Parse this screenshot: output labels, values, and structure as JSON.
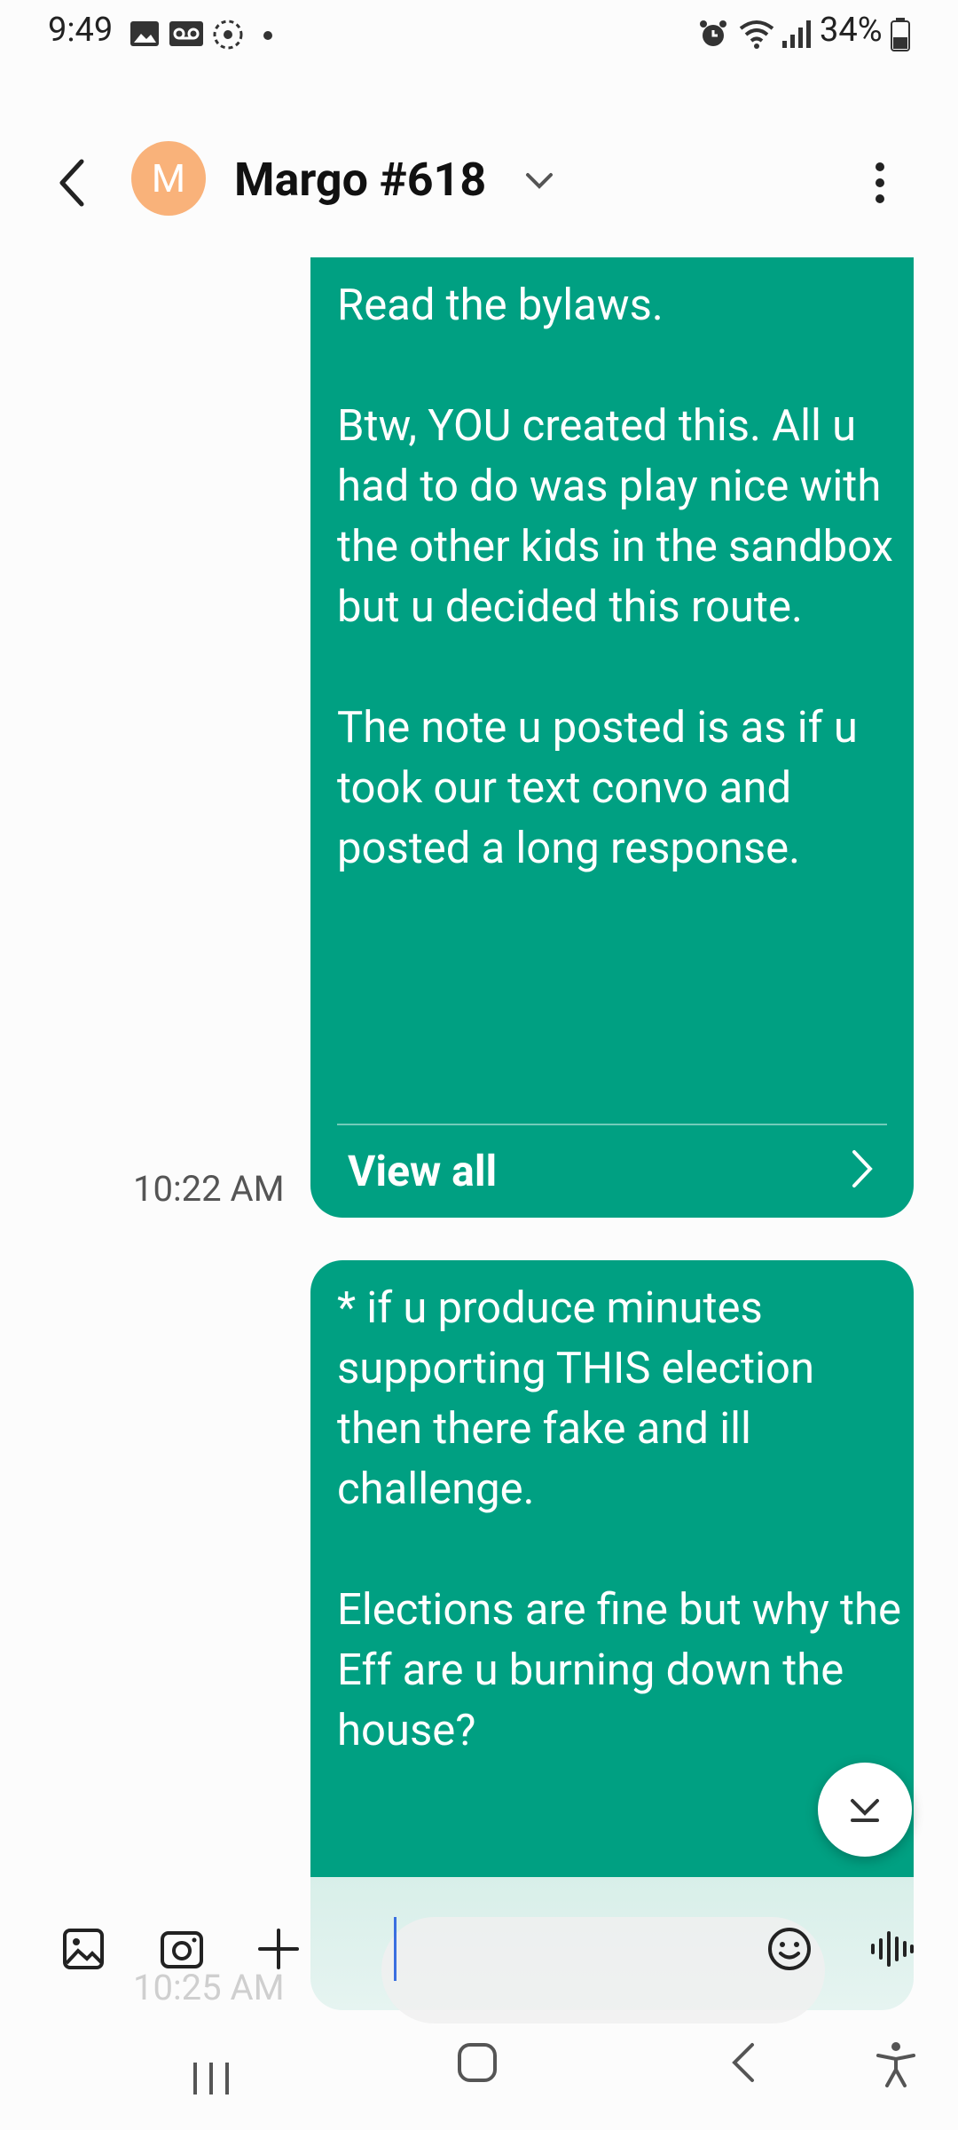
{
  "status_bar": {
    "time": "9:49",
    "battery_percent": "34%"
  },
  "header": {
    "avatar_letter": "M",
    "contact_name": "Margo #618"
  },
  "messages": [
    {
      "text": "Read the bylaws.\n\nBtw, YOU created this. All u had to do was play nice with the other kids in the sandbox but u decided this route.\n\nThe note u posted is as if u took our text convo and posted a long response.",
      "view_all_label": "View all",
      "time": "10:22 AM"
    },
    {
      "text": "* if u produce minutes supporting THIS election then there fake and ill challenge.\n\nElections are fine but why the Eff are u burning down the house?",
      "time": "10:25 AM"
    }
  ],
  "composer": {
    "placeholder": ""
  },
  "colors": {
    "bubble": "#00a082",
    "avatar": "#f9b27a",
    "cursor": "#3a6fe0"
  },
  "icons": [
    "back-arrow-icon",
    "chevron-down-icon",
    "more-vertical-icon",
    "gallery-icon",
    "camera-icon",
    "plus-icon",
    "emoji-icon",
    "voice-icon",
    "recents-icon",
    "home-icon",
    "back-nav-icon",
    "accessibility-icon"
  ]
}
